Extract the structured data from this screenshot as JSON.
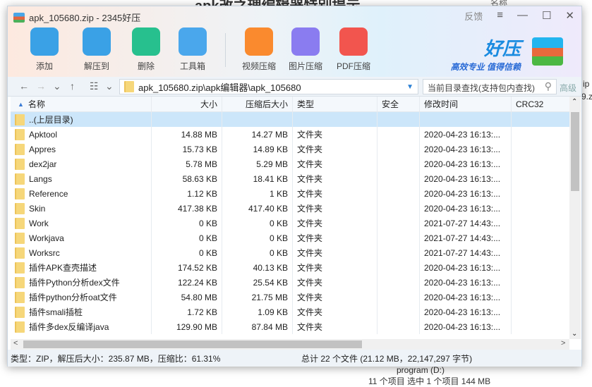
{
  "background": {
    "top_text": "apk改之理编辑器特别提示",
    "right_header": "名称",
    "right_frag1": "ip",
    "right_frag2": "9.z",
    "bottom_drive": "program (D:)",
    "bottom_status": "11 个项目    选中 1 个项目 144 MB"
  },
  "window": {
    "title": "apk_105680.zip - 2345好压",
    "feedback": "反馈",
    "menu_icon": "≡",
    "minimize": "—",
    "maximize": "☐",
    "close": "✕"
  },
  "toolbar": [
    {
      "label": "添加",
      "icon": "add-archive-icon",
      "color": "#3aa1e6"
    },
    {
      "label": "解压到",
      "icon": "extract-icon",
      "color": "#3aa1e6"
    },
    {
      "label": "删除",
      "icon": "recycle-bin-icon",
      "color": "#27c08e"
    },
    {
      "label": "工具箱",
      "icon": "toolbox-icon",
      "color": "#4aa7ec"
    },
    {
      "label": "视频压缩",
      "icon": "video-compress-icon",
      "color": "#fa8a2e"
    },
    {
      "label": "图片压缩",
      "icon": "image-compress-icon",
      "color": "#8a7cf0"
    },
    {
      "label": "PDF压缩",
      "icon": "pdf-compress-icon",
      "color": "#f2554e"
    }
  ],
  "logo": {
    "name": "好压",
    "slogan": "高效专业  值得信赖"
  },
  "nav": {
    "back": "←",
    "forward": "→",
    "history": "⌄",
    "up": "↑",
    "view": "☷",
    "view_dd": "⌄",
    "path": "apk_105680.zip\\apk编辑器\\apk_105680",
    "search_placeholder": "当前目录查找(支持包内查找)",
    "advanced": "高级"
  },
  "columns": [
    "名称",
    "大小",
    "压缩后大小",
    "类型",
    "安全",
    "修改时间",
    "CRC32"
  ],
  "rows": [
    {
      "name": "..(上层目录)",
      "size": "",
      "packed": "",
      "type": "",
      "safe": "",
      "time": "",
      "crc": ""
    },
    {
      "name": "Apktool",
      "size": "14.88 MB",
      "packed": "14.27 MB",
      "type": "文件夹",
      "safe": "",
      "time": "2020-04-23 16:13:...",
      "crc": ""
    },
    {
      "name": "Appres",
      "size": "15.73 KB",
      "packed": "14.89 KB",
      "type": "文件夹",
      "safe": "",
      "time": "2020-04-23 16:13:...",
      "crc": ""
    },
    {
      "name": "dex2jar",
      "size": "5.78 MB",
      "packed": "5.29 MB",
      "type": "文件夹",
      "safe": "",
      "time": "2020-04-23 16:13:...",
      "crc": ""
    },
    {
      "name": "Langs",
      "size": "58.63 KB",
      "packed": "18.41 KB",
      "type": "文件夹",
      "safe": "",
      "time": "2020-04-23 16:13:...",
      "crc": ""
    },
    {
      "name": "Reference",
      "size": "1.12 KB",
      "packed": "1 KB",
      "type": "文件夹",
      "safe": "",
      "time": "2020-04-23 16:13:...",
      "crc": ""
    },
    {
      "name": "Skin",
      "size": "417.38 KB",
      "packed": "417.40 KB",
      "type": "文件夹",
      "safe": "",
      "time": "2020-04-23 16:13:...",
      "crc": ""
    },
    {
      "name": "Work",
      "size": "0 KB",
      "packed": "0 KB",
      "type": "文件夹",
      "safe": "",
      "time": "2021-07-27 14:43:...",
      "crc": ""
    },
    {
      "name": "Workjava",
      "size": "0 KB",
      "packed": "0 KB",
      "type": "文件夹",
      "safe": "",
      "time": "2021-07-27 14:43:...",
      "crc": ""
    },
    {
      "name": "Worksrc",
      "size": "0 KB",
      "packed": "0 KB",
      "type": "文件夹",
      "safe": "",
      "time": "2021-07-27 14:43:...",
      "crc": ""
    },
    {
      "name": "插件APK查壳描述",
      "size": "174.52 KB",
      "packed": "40.13 KB",
      "type": "文件夹",
      "safe": "",
      "time": "2020-04-23 16:13:...",
      "crc": ""
    },
    {
      "name": "插件Python分析dex文件",
      "size": "122.24 KB",
      "packed": "25.54 KB",
      "type": "文件夹",
      "safe": "",
      "time": "2020-04-23 16:13:...",
      "crc": ""
    },
    {
      "name": "插件python分析oat文件",
      "size": "54.80 MB",
      "packed": "21.75 MB",
      "type": "文件夹",
      "safe": "",
      "time": "2020-04-23 16:13:...",
      "crc": ""
    },
    {
      "name": "插件smali插桩",
      "size": "1.72 KB",
      "packed": "1.09 KB",
      "type": "文件夹",
      "safe": "",
      "time": "2020-04-23 16:13:...",
      "crc": ""
    },
    {
      "name": "插件多dex反编译java",
      "size": "129.90 MB",
      "packed": "87.84 MB",
      "type": "文件夹",
      "safe": "",
      "time": "2020-04-23 16:13:...",
      "crc": ""
    }
  ],
  "scroll": {
    "up": "⌃",
    "down": "⌄",
    "left": "<",
    "right": ">"
  },
  "status": {
    "left": "类型：ZIP，解压后大小：235.87 MB，压缩比：61.31%",
    "right": "总计 22 个文件 (21.12 MB，22,147,297 字节)"
  }
}
